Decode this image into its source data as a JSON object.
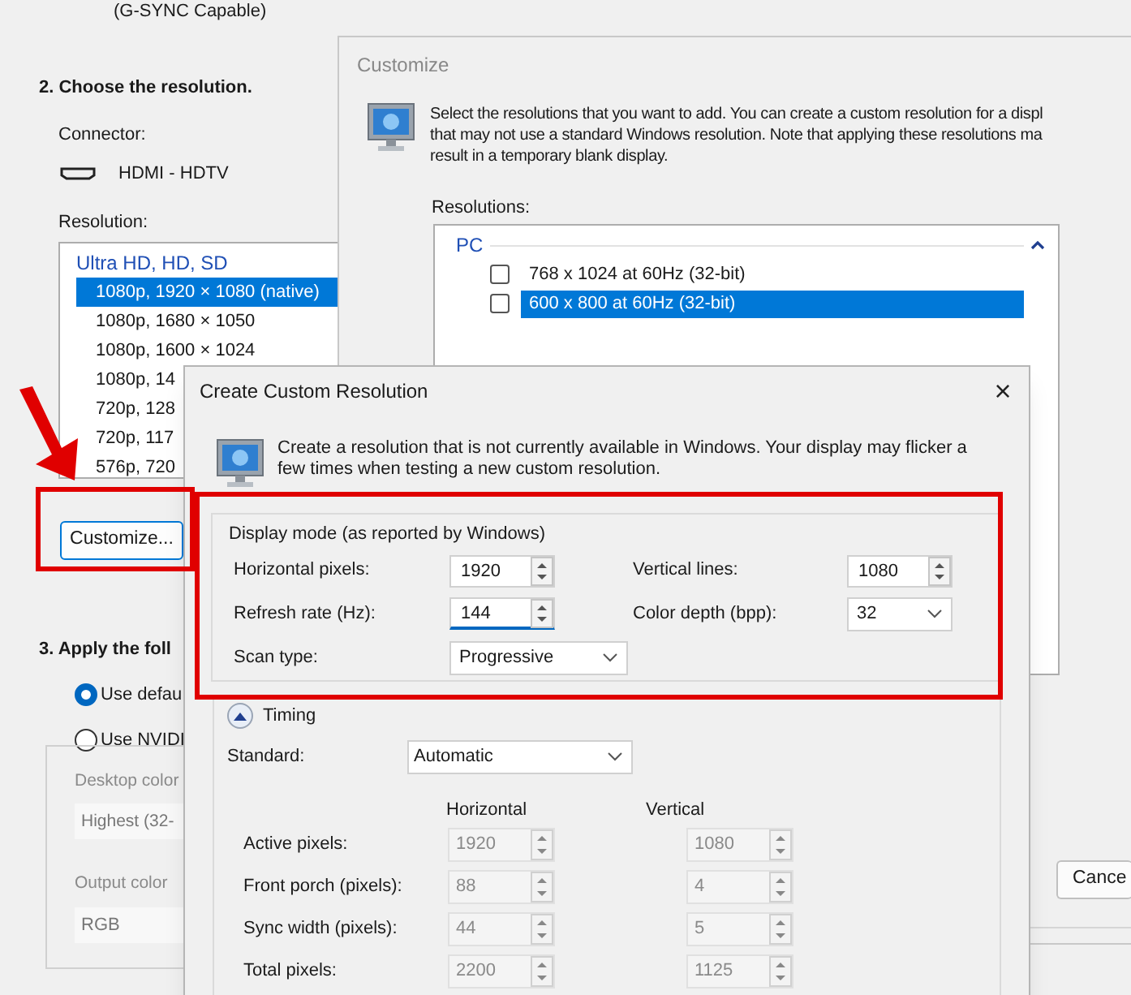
{
  "panel": {
    "caption": "(G-SYNC Capable)",
    "step2_title": "2. Choose the resolution.",
    "connector_label": "Connector:",
    "connector_value": "HDMI - HDTV",
    "resolution_label": "Resolution:",
    "resolution_list": {
      "group": "Ultra HD, HD, SD",
      "items": [
        {
          "label": "1080p, 1920 × 1080 (native)",
          "selected": true
        },
        {
          "label": "1080p, 1680 × 1050",
          "selected": false
        },
        {
          "label": "1080p, 1600 × 1024",
          "selected": false
        },
        {
          "label": "1080p, 14",
          "selected": false
        },
        {
          "label": "720p, 128",
          "selected": false
        },
        {
          "label": "720p, 117",
          "selected": false
        },
        {
          "label": "576p, 720",
          "selected": false
        }
      ]
    },
    "customize_button": "Customize...",
    "step3_title": "3. Apply the foll",
    "color_options": [
      {
        "label": "Use defau",
        "selected": true
      },
      {
        "label": "Use NVIDI",
        "selected": false
      }
    ],
    "desktop_color_label": "Desktop color",
    "desktop_color_value": "Highest (32-",
    "output_color_label": "Output color",
    "output_color_value": "RGB"
  },
  "customize_dialog": {
    "title": "Customize",
    "description_lines": [
      "Select the resolutions that you want to add. You can create a custom resolution for a displ",
      "that may not use a standard Windows resolution. Note that applying these resolutions ma",
      "result in a temporary blank display."
    ],
    "resolutions_label": "Resolutions:",
    "group": "PC",
    "items": [
      {
        "label": "768 x 1024 at 60Hz (32-bit)",
        "checked": false,
        "selected": false
      },
      {
        "label": "600 x 800 at 60Hz (32-bit)",
        "checked": false,
        "selected": true
      }
    ],
    "cancel_button": "Cance"
  },
  "custom_resolution_dialog": {
    "title": "Create Custom Resolution",
    "close": "×",
    "description": "Create a resolution that is not currently available in Windows. Your display may flicker a few times when testing a new custom resolution.",
    "display_mode": {
      "title": "Display mode (as reported by Windows)",
      "fields": [
        {
          "label": "Horizontal pixels:",
          "value": "1920",
          "kind": "spin",
          "focused": false
        },
        {
          "label": "Vertical lines:",
          "value": "1080",
          "kind": "spin",
          "focused": false
        },
        {
          "label": "Refresh rate (Hz):",
          "value": "144",
          "kind": "spin",
          "focused": true
        },
        {
          "label": "Color depth (bpp):",
          "value": "32",
          "kind": "select",
          "focused": false
        },
        {
          "label": "Scan type:",
          "value": "Progressive",
          "kind": "select",
          "focused": false
        }
      ]
    },
    "timing": {
      "title": "Timing",
      "expanded": true,
      "standard_label": "Standard:",
      "standard_value": "Automatic",
      "column_headers": [
        "Horizontal",
        "Vertical"
      ],
      "rows": [
        {
          "label": "Active pixels:",
          "horizontal": "1920",
          "vertical": "1080",
          "disabled": true
        },
        {
          "label": "Front porch (pixels):",
          "horizontal": "88",
          "vertical": "4",
          "disabled": true
        },
        {
          "label": "Sync width (pixels):",
          "horizontal": "44",
          "vertical": "5",
          "disabled": true
        },
        {
          "label": "Total pixels:",
          "horizontal": "2200",
          "vertical": "1125",
          "disabled": true
        }
      ]
    }
  }
}
